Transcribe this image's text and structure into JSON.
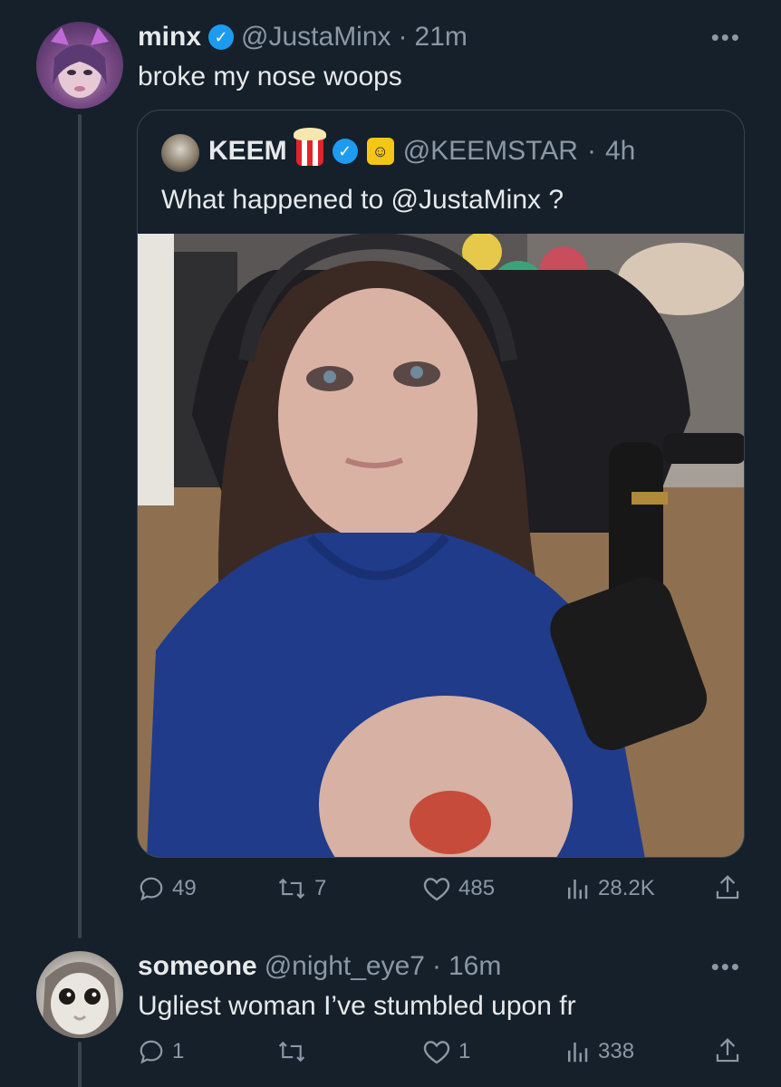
{
  "colors": {
    "background": "#15202b",
    "text": "#e7e9ea",
    "muted": "#8b98a5",
    "verified": "#1d9bf0",
    "border": "#38444d"
  },
  "tweet1": {
    "name": "minx",
    "handle": "@JustaMinx",
    "time": "21m",
    "text": "broke my nose woops",
    "avatar_icon": "avatar-cat-ears",
    "quote": {
      "name": "KEEM",
      "handle": "@KEEMSTAR",
      "time": "4h",
      "text": "What happened to @JustaMinx ?",
      "badges": [
        "popcorn-icon",
        "verified-icon",
        "smiley-badge-icon"
      ]
    },
    "actions": {
      "replies": "49",
      "retweets": "7",
      "likes": "485",
      "views": "28.2K"
    }
  },
  "tweet2": {
    "name": "someone",
    "handle": "@night_eye7",
    "time": "16m",
    "text": "Ugliest woman I’ve stumbled upon fr",
    "actions": {
      "replies": "1",
      "retweets": "",
      "likes": "1",
      "views": "338"
    }
  },
  "separator": "·"
}
